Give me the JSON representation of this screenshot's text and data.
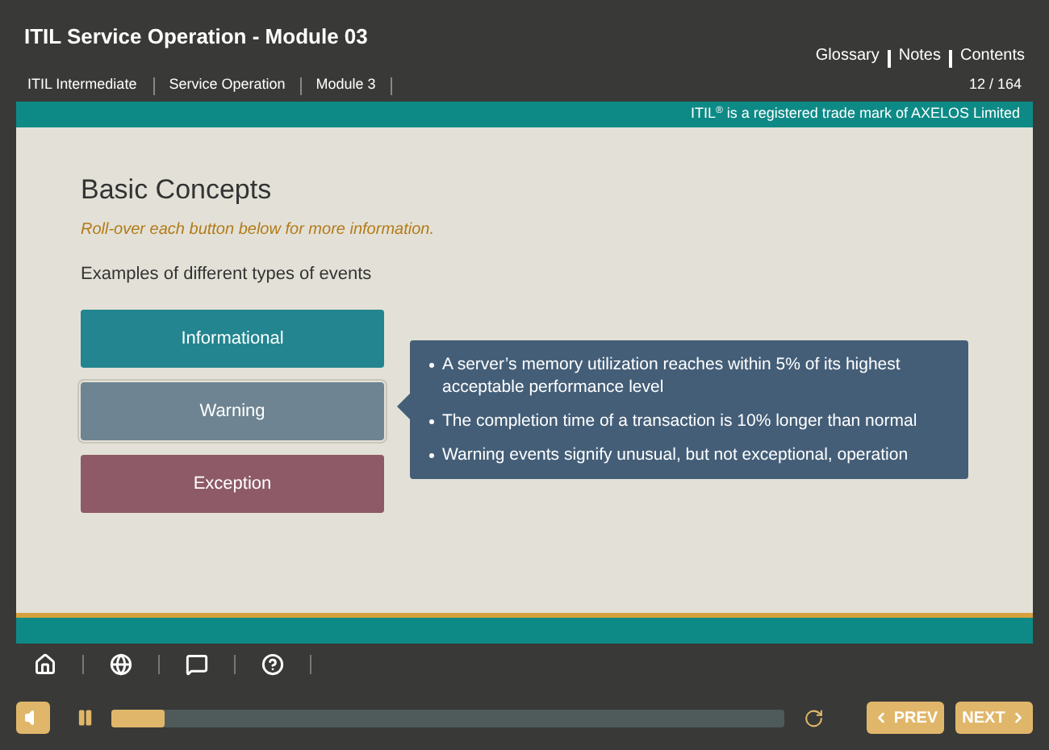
{
  "header": {
    "title": "ITIL Service Operation - Module 03",
    "links": [
      "Glossary",
      "Notes",
      "Contents"
    ],
    "breadcrumbs": [
      "ITIL Intermediate",
      "Service Operation",
      "Module 3"
    ],
    "page_count": "12 / 164"
  },
  "banner": {
    "prefix": "ITIL",
    "superscript": "®",
    "text": " is a registered trade mark of AXELOS Limited"
  },
  "slide": {
    "title": "Basic Concepts",
    "instruction": "Roll-over each button below for more information.",
    "subtitle": "Examples of different types of events",
    "buttons": [
      {
        "label": "Informational",
        "color": "#22858f",
        "selected": false
      },
      {
        "label": "Warning",
        "color": "#6e8492",
        "selected": true
      },
      {
        "label": "Exception",
        "color": "#8e5a67",
        "selected": false
      }
    ],
    "callout": {
      "items": [
        "A server’s memory utilization reaches within 5% of its highest acceptable performance level",
        "The completion time of a transaction is 10% longer than normal",
        "Warning events signify unusual, but not exceptional, operation"
      ]
    }
  },
  "toolbar": [
    {
      "kind": "home"
    },
    {
      "kind": "globe"
    },
    {
      "kind": "chat"
    },
    {
      "kind": "help"
    }
  ],
  "player": {
    "level": 0.08,
    "prev": "PREV",
    "next": "NEXT"
  }
}
